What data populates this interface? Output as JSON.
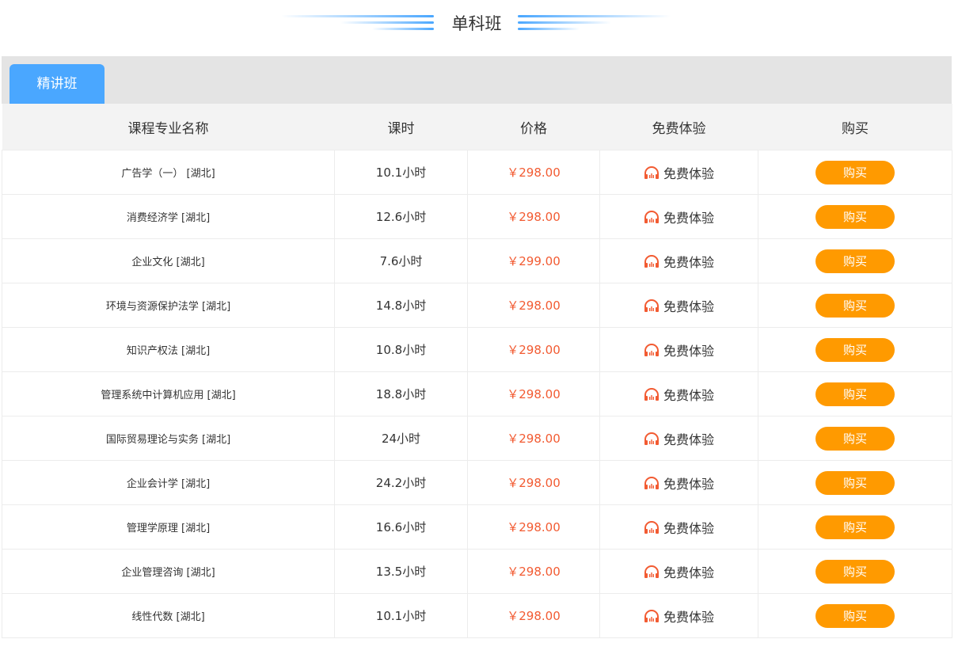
{
  "header": {
    "title": "单科班"
  },
  "tabs": [
    {
      "label": "精讲班",
      "active": true
    }
  ],
  "table": {
    "columns": [
      "课程专业名称",
      "课时",
      "价格",
      "免费体验",
      "购买"
    ],
    "rows": [
      {
        "name": "广告学（一） [湖北]",
        "hours": "10.1小时",
        "price": "￥298.00",
        "trial": "免费体验",
        "buy": "购买"
      },
      {
        "name": "消费经济学 [湖北]",
        "hours": "12.6小时",
        "price": "￥298.00",
        "trial": "免费体验",
        "buy": "购买"
      },
      {
        "name": "企业文化 [湖北]",
        "hours": "7.6小时",
        "price": "￥299.00",
        "trial": "免费体验",
        "buy": "购买"
      },
      {
        "name": "环境与资源保护法学 [湖北]",
        "hours": "14.8小时",
        "price": "￥298.00",
        "trial": "免费体验",
        "buy": "购买"
      },
      {
        "name": "知识产权法 [湖北]",
        "hours": "10.8小时",
        "price": "￥298.00",
        "trial": "免费体验",
        "buy": "购买"
      },
      {
        "name": "管理系统中计算机应用 [湖北]",
        "hours": "18.8小时",
        "price": "￥298.00",
        "trial": "免费体验",
        "buy": "购买"
      },
      {
        "name": "国际贸易理论与实务 [湖北]",
        "hours": "24小时",
        "price": "￥298.00",
        "trial": "免费体验",
        "buy": "购买"
      },
      {
        "name": "企业会计学 [湖北]",
        "hours": "24.2小时",
        "price": "￥298.00",
        "trial": "免费体验",
        "buy": "购买"
      },
      {
        "name": "管理学原理 [湖北]",
        "hours": "16.6小时",
        "price": "￥298.00",
        "trial": "免费体验",
        "buy": "购买"
      },
      {
        "name": "企业管理咨询 [湖北]",
        "hours": "13.5小时",
        "price": "￥298.00",
        "trial": "免费体验",
        "buy": "购买"
      },
      {
        "name": "线性代数 [湖北]",
        "hours": "10.1小时",
        "price": "￥298.00",
        "trial": "免费体验",
        "buy": "购买"
      }
    ]
  },
  "icons": {
    "trial_icon": "headphones-icon"
  },
  "colors": {
    "accent": "#4aa7ff",
    "price": "#f25b32",
    "buy_button": "#ff9a00"
  }
}
